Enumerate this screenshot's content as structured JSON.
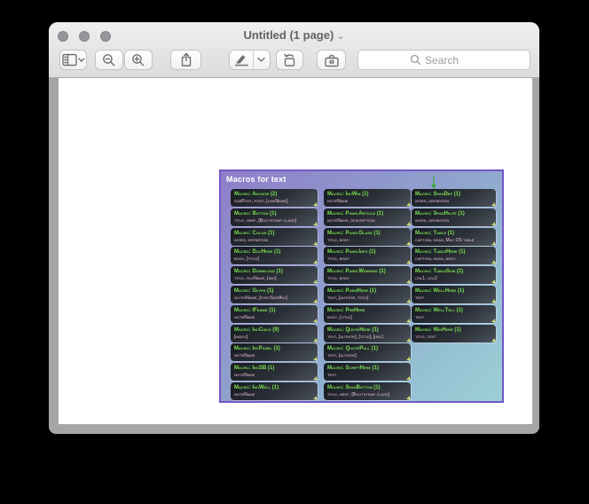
{
  "window": {
    "title": "Untitled (1 page)",
    "title_chevron": "⌄",
    "traffic_lights": [
      "close",
      "minimize",
      "zoom"
    ]
  },
  "toolbar": {
    "search_placeholder": "Search",
    "icons": {
      "sidebar-icon": "panel+lines",
      "chevron-down-icon": "⌄",
      "zoom-out-icon": "magnifier-minus",
      "zoom-in-icon": "magnifier-plus",
      "share-icon": "box-up-arrow",
      "markup-pen-icon": "pen-nib",
      "rotate-left-icon": "rect-ccw-arrow",
      "markup-toolbar-icon": "toolbox",
      "search-icon": "magnifier"
    }
  },
  "colors": {
    "diagram_border": "#7257c8",
    "diagram_purple": "#8f7ec9",
    "diagram_teal": "#9dd0d6",
    "box_title_green": "#7be052",
    "box_param_pink": "#f2c3da",
    "corner_marker": "#cfe06e",
    "arrow_green": "#3aa83c"
  },
  "diagram": {
    "title": "Macros for text",
    "columns": [
      {
        "boxes": [
          {
            "title": "Macro: Anchor (2)",
            "params": "subPost, post, [linkName]"
          },
          {
            "title": "Macro: Button (1)",
            "params": "title, href, [Bootstrap class]"
          },
          {
            "title": "Macro: Color (1)",
            "params": "word, definition"
          },
          {
            "title": "Macro: DocHere (1)",
            "params": "body, [title]"
          },
          {
            "title": "Macro: Download (1)",
            "params": "title, fileName, [img]"
          },
          {
            "title": "Macro: Glyph (1)",
            "params": "glyphName, [fontSizeAdj]"
          },
          {
            "title": "Macro: IFrame (1)",
            "params": "noteName"
          },
          {
            "title": "Macro: IncChild (9)",
            "params": "[index]"
          },
          {
            "title": "Macro: IncPanel (1)",
            "params": "noteName"
          },
          {
            "title": "Macro: IncSB (1)",
            "params": "noteName"
          },
          {
            "title": "Macro: IncWell (1)",
            "params": "noteName"
          }
        ]
      },
      {
        "boxes": [
          {
            "title": "Macro: IncWin (1)",
            "params": "noteName"
          },
          {
            "title": "Macro: PanelArticle (1)",
            "params": "noteName, description"
          },
          {
            "title": "Macro: PanelGlass (1)",
            "params": "title, body"
          },
          {
            "title": "Macro: PanelInfo (1)",
            "params": "title, body"
          },
          {
            "title": "Macro: PanelWarning (1)",
            "params": "title, body"
          },
          {
            "title": "Macro: PoemHere (1)",
            "params": "text, [author, title]"
          },
          {
            "title": "Macro: PreHere",
            "params": "body, [title]"
          },
          {
            "title": "Macro: QuoteHere (1)",
            "params": "text, [author], [title], [url]"
          },
          {
            "title": "Macro: QuotePull (1)",
            "params": "text, [author]"
          },
          {
            "title": "Macro: ScriptHere (1)",
            "params": "text"
          },
          {
            "title": "Macro: SpanButton (1)",
            "params": "title, href, [Bootstrap class]"
          }
        ]
      },
      {
        "boxes": [
          {
            "title": "Macro: SpanDef (1)",
            "params": "word, definition"
          },
          {
            "title": "Macro: SpanHilite (1)",
            "params": "word, definition"
          },
          {
            "title": "Macro: Table (1)",
            "params": "caption, head, Mac OS table"
          },
          {
            "title": "Macro: TableHere (1)",
            "params": "caption, head, body"
          },
          {
            "title": "Macro: TableSum (2)",
            "params": "col1, col2"
          },
          {
            "title": "Macro: WellHere (1)",
            "params": "text"
          },
          {
            "title": "Macro: WellTell (1)",
            "params": "text"
          },
          {
            "title": "Macro: WinHere (1)",
            "params": "title, text"
          }
        ]
      }
    ]
  }
}
